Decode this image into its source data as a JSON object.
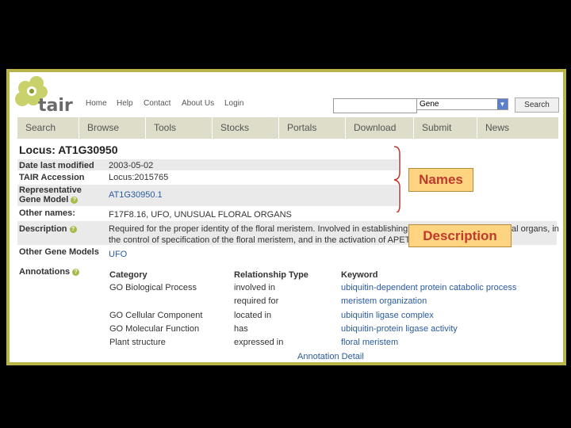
{
  "site": {
    "logo_text": "tair"
  },
  "top_nav": [
    "Home",
    "Help",
    "Contact",
    "About Us",
    "Login"
  ],
  "search": {
    "query": "",
    "type_selected": "Gene",
    "button_label": "Search"
  },
  "main_nav": [
    "Search",
    "Browse",
    "Tools",
    "Stocks",
    "Portals",
    "Download",
    "Submit",
    "News"
  ],
  "locus": {
    "title": "Locus: AT1G30950",
    "fields": [
      {
        "label": "Date last modified",
        "value": "2003-05-02"
      },
      {
        "label": "TAIR Accession",
        "value": "Locus:2015765"
      },
      {
        "label_line1": "Representative",
        "label_line2": "Gene Model",
        "value": "AT1G30950.1"
      },
      {
        "label": "Other names:",
        "value": "F17F8.16, UFO, UNUSUAL FLORAL ORGANS"
      },
      {
        "label": "Description",
        "line1": "Required for the proper identity of the floral meristem. Involved in establishing",
        "line1_end": "al organs, in",
        "line2": "the control of specification of the floral meristem, and in the activation of APET"
      },
      {
        "label": "Other Gene Models",
        "value": "UFO"
      },
      {
        "label": "Annotations"
      }
    ]
  },
  "annotations": {
    "headers": [
      "Category",
      "Relationship Type",
      "Keyword"
    ],
    "rows": [
      [
        "GO Biological Process",
        "involved in",
        "ubiquitin-dependent protein catabolic process"
      ],
      [
        "",
        "required for",
        "meristem organization"
      ],
      [
        "GO Cellular Component",
        "located in",
        "ubiquitin ligase complex"
      ],
      [
        "GO Molecular Function",
        "has",
        "ubiquitin-protein ligase activity"
      ],
      [
        "Plant structure",
        "expressed in",
        "floral meristem"
      ]
    ],
    "detail_link": "Annotation Detail"
  },
  "callouts": {
    "names": "Names",
    "description": "Description"
  },
  "colors": {
    "frame": "#b9b44a",
    "nav_bg": "#ddddc9",
    "link": "#2a5aa0",
    "callout_bg": "#ffd480",
    "callout_text": "#c0392b",
    "brace": "#c0392b"
  }
}
